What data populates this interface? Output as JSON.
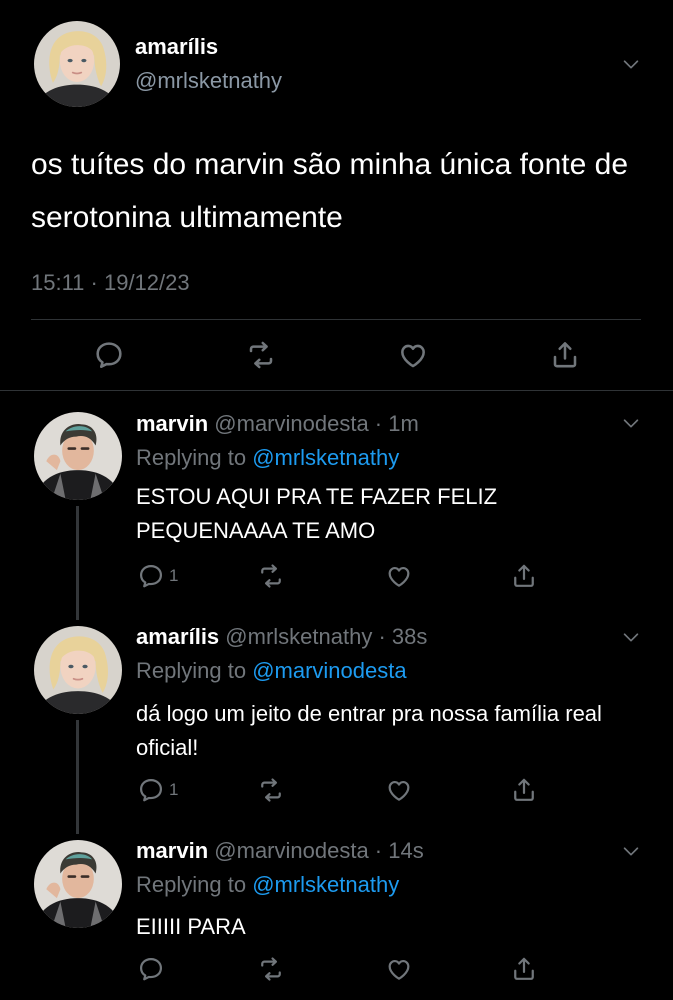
{
  "main_tweet": {
    "display_name": "amarílis",
    "handle": "@mrlsketnathy",
    "text": "os tuítes do marvin são minha única fonte de serotonina ultimamente",
    "timestamp": "15:11 · 19/12/23",
    "actions": [
      "reply",
      "retweet",
      "like",
      "share"
    ]
  },
  "replies": [
    {
      "display_name": "marvin",
      "handle": "@marvinodesta",
      "separator": " · ",
      "time": "1m",
      "replying_prefix": "Replying to ",
      "replying_to": "@mrlsketnathy",
      "text": "ESTOU AQUI PRA TE FAZER FELIZ PEQUENAAAA TE AMO",
      "reply_count": "1"
    },
    {
      "display_name": "amarílis",
      "handle": "@mrlsketnathy",
      "separator": " · ",
      "time": "38s",
      "replying_prefix": "Replying to ",
      "replying_to": "@marvinodesta",
      "text": "dá logo um jeito de entrar pra nossa família real oficial!",
      "reply_count": "1"
    },
    {
      "display_name": "marvin",
      "handle": "@marvinodesta",
      "separator": " · ",
      "time": "14s",
      "replying_prefix": "Replying to ",
      "replying_to": "@mrlsketnathy",
      "text": "EIIIII PARA",
      "reply_count": ""
    }
  ],
  "colors": {
    "background": "#000000",
    "text": "#ffffff",
    "muted": "#71767b",
    "accent": "#1d9bf0",
    "divider": "#2f3336"
  },
  "icons": [
    "chevron-down-icon",
    "reply-icon",
    "retweet-icon",
    "like-icon",
    "share-icon"
  ]
}
